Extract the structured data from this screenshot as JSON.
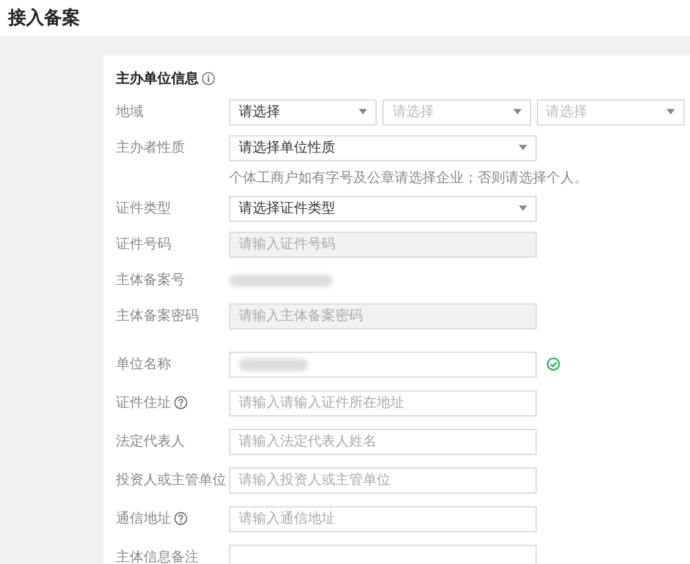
{
  "page_title": "接入备案",
  "section": {
    "title": "主办单位信息",
    "info": true
  },
  "rows": [
    {
      "kind": "selects",
      "label": "地域",
      "selects": [
        {
          "text": "请选择",
          "disabled": false
        },
        {
          "text": "请选择",
          "disabled": true
        },
        {
          "text": "请选择",
          "disabled": true
        }
      ]
    },
    {
      "kind": "select",
      "label": "主办者性质",
      "text": "请选择单位性质",
      "hint": "个体工商户如有字号及公章请选择企业；否则请选择个人。"
    },
    {
      "kind": "select",
      "label": "证件类型",
      "text": "请选择证件类型"
    },
    {
      "kind": "input",
      "label": "证件号码",
      "placeholder": "请输入证件号码",
      "disabled": true,
      "help": false
    },
    {
      "kind": "redacted",
      "label": "主体备案号"
    },
    {
      "kind": "input",
      "label": "主体备案密码",
      "placeholder": "请输入主体备案密码",
      "disabled": true,
      "help": false
    },
    {
      "kind": "redacted-input",
      "label": "单位名称",
      "valid": true
    },
    {
      "kind": "input",
      "label": "证件住址",
      "placeholder": "请输入请输入证件所在地址",
      "disabled": false,
      "help": true
    },
    {
      "kind": "input",
      "label": "法定代表人",
      "placeholder": "请输入法定代表人姓名",
      "disabled": false,
      "help": false
    },
    {
      "kind": "input",
      "label": "投资人或主管单位",
      "placeholder": "请输入投资人或主管单位",
      "disabled": false,
      "help": false
    },
    {
      "kind": "input",
      "label": "通信地址",
      "placeholder": "请输入通信地址",
      "disabled": false,
      "help": true
    },
    {
      "kind": "input",
      "label": "主体信息备注",
      "placeholder": "",
      "disabled": false,
      "help": false
    }
  ]
}
